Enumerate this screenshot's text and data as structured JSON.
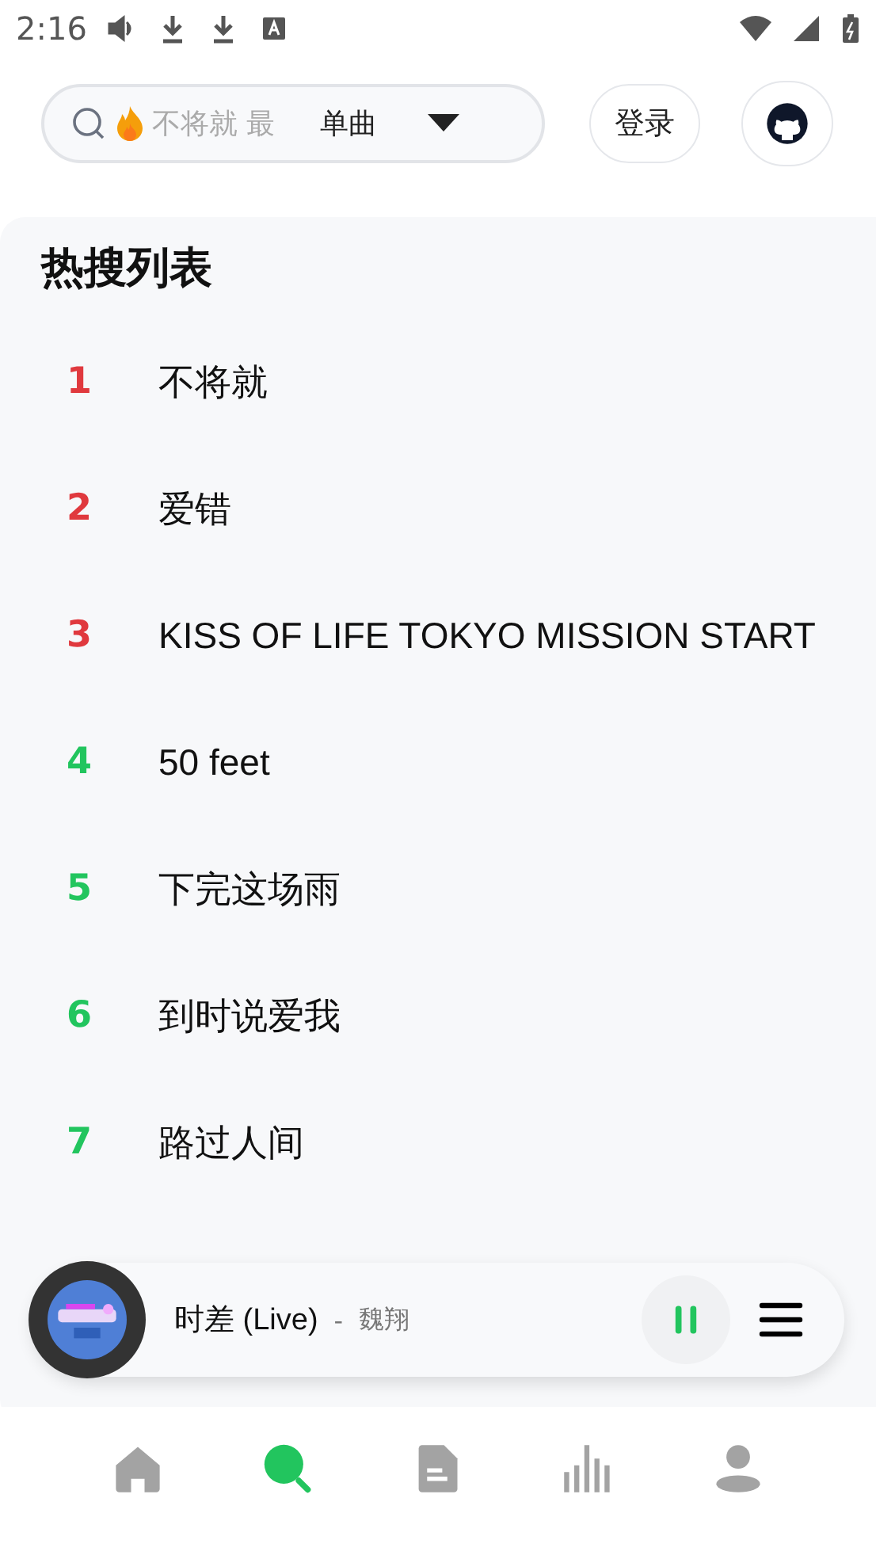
{
  "status_bar": {
    "time": "2:16"
  },
  "search": {
    "placeholder": "不将就 最",
    "type_label": "单曲"
  },
  "login_button": "登录",
  "hot_list": {
    "title": "热搜列表",
    "items": [
      {
        "rank": "1",
        "title": "不将就",
        "color": "#e0393e"
      },
      {
        "rank": "2",
        "title": "爱错",
        "color": "#e0393e"
      },
      {
        "rank": "3",
        "title": "KISS OF LIFE TOKYO MISSION START",
        "color": "#e0393e"
      },
      {
        "rank": "4",
        "title": "50 feet",
        "color": "#22c55e"
      },
      {
        "rank": "5",
        "title": "下完这场雨",
        "color": "#22c55e"
      },
      {
        "rank": "6",
        "title": "到时说爱我",
        "color": "#22c55e"
      },
      {
        "rank": "7",
        "title": "路过人间",
        "color": "#22c55e"
      }
    ]
  },
  "player": {
    "song": "时差 (Live)",
    "separator": "-",
    "artist": "魏翔",
    "playing": true
  },
  "nav": [
    {
      "kind": "home",
      "selected": false
    },
    {
      "kind": "search",
      "selected": true
    },
    {
      "kind": "doc",
      "selected": false
    },
    {
      "kind": "chart",
      "selected": false
    },
    {
      "kind": "user",
      "selected": false
    }
  ]
}
